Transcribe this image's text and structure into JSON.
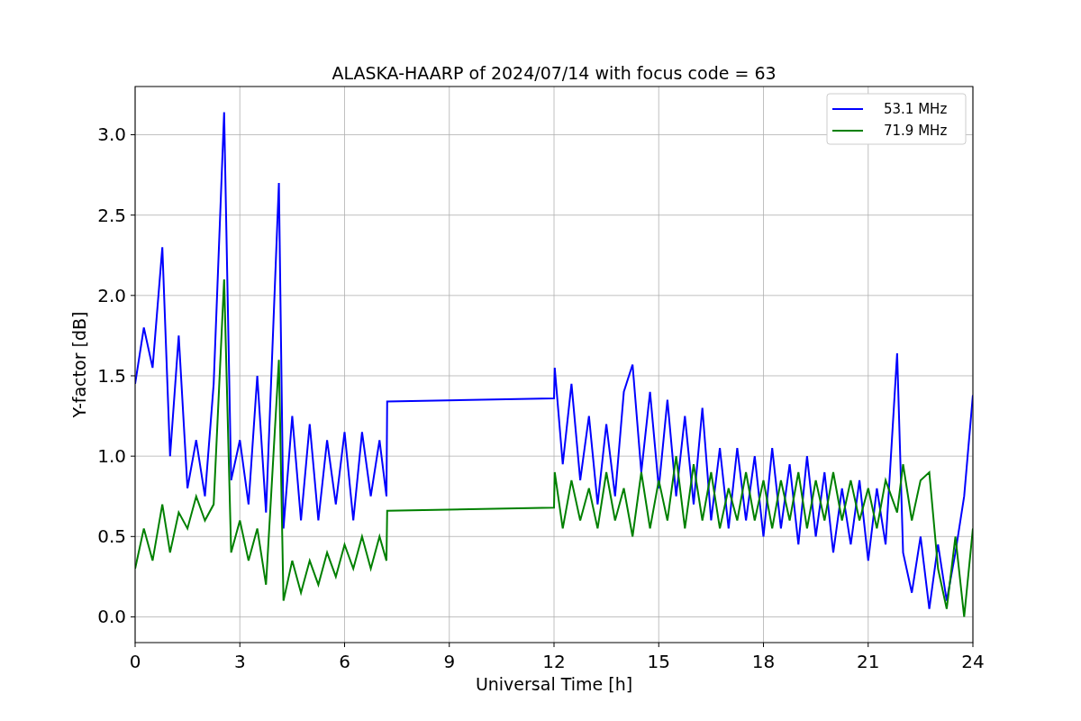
{
  "figure": {
    "chart_data": {
      "type": "line",
      "title": "ALASKA-HAARP of 2024/07/14 with focus code = 63",
      "xlabel": "Universal Time [h]",
      "ylabel": "Y-factor [dB]",
      "x": [
        0,
        0.25,
        0.5,
        0.78,
        1.0,
        1.25,
        1.5,
        1.75,
        2.0,
        2.25,
        2.55,
        2.75,
        3.0,
        3.25,
        3.5,
        3.75,
        4.12,
        4.25,
        4.5,
        4.75,
        5.0,
        5.25,
        5.5,
        5.75,
        6.0,
        6.25,
        6.5,
        6.75,
        7.0,
        7.2,
        7.22,
        12.0,
        12.02,
        12.25,
        12.5,
        12.75,
        13.0,
        13.25,
        13.5,
        13.75,
        14.0,
        14.25,
        14.5,
        14.75,
        15.0,
        15.25,
        15.5,
        15.75,
        16.0,
        16.25,
        16.5,
        16.75,
        17.0,
        17.25,
        17.5,
        17.75,
        18.0,
        18.25,
        18.5,
        18.75,
        19.0,
        19.25,
        19.5,
        19.75,
        20.0,
        20.25,
        20.5,
        20.75,
        21.0,
        21.25,
        21.5,
        21.83,
        22.0,
        22.25,
        22.5,
        22.75,
        23.0,
        23.25,
        23.5,
        23.75,
        24.0
      ],
      "series": [
        {
          "name": "53.1 MHz",
          "color": "#0000ff",
          "values": [
            1.45,
            1.8,
            1.55,
            2.3,
            1.0,
            1.75,
            0.8,
            1.1,
            0.75,
            1.45,
            3.14,
            0.85,
            1.1,
            0.7,
            1.5,
            0.65,
            2.7,
            0.55,
            1.25,
            0.6,
            1.2,
            0.6,
            1.1,
            0.7,
            1.15,
            0.6,
            1.15,
            0.75,
            1.1,
            0.75,
            1.34,
            1.36,
            1.55,
            0.95,
            1.45,
            0.85,
            1.25,
            0.7,
            1.2,
            0.75,
            1.4,
            1.57,
            0.9,
            1.4,
            0.8,
            1.35,
            0.75,
            1.25,
            0.7,
            1.3,
            0.6,
            1.05,
            0.55,
            1.05,
            0.6,
            1.0,
            0.5,
            1.05,
            0.55,
            0.95,
            0.45,
            1.0,
            0.5,
            0.9,
            0.4,
            0.8,
            0.45,
            0.85,
            0.35,
            0.8,
            0.45,
            1.64,
            0.4,
            0.15,
            0.5,
            0.05,
            0.45,
            0.1,
            0.4,
            0.75,
            1.38
          ]
        },
        {
          "name": "71.9 MHz",
          "color": "#008000",
          "values": [
            0.3,
            0.55,
            0.35,
            0.7,
            0.4,
            0.65,
            0.55,
            0.75,
            0.6,
            0.7,
            2.1,
            0.4,
            0.6,
            0.35,
            0.55,
            0.2,
            1.6,
            0.1,
            0.35,
            0.15,
            0.35,
            0.2,
            0.4,
            0.25,
            0.45,
            0.3,
            0.5,
            0.3,
            0.5,
            0.35,
            0.66,
            0.68,
            0.9,
            0.55,
            0.85,
            0.6,
            0.8,
            0.55,
            0.9,
            0.6,
            0.8,
            0.5,
            0.9,
            0.55,
            0.85,
            0.6,
            1.0,
            0.55,
            0.95,
            0.6,
            0.9,
            0.55,
            0.8,
            0.6,
            0.9,
            0.6,
            0.85,
            0.55,
            0.85,
            0.6,
            0.9,
            0.55,
            0.85,
            0.6,
            0.9,
            0.6,
            0.85,
            0.6,
            0.8,
            0.55,
            0.85,
            0.65,
            0.95,
            0.6,
            0.85,
            0.9,
            0.3,
            0.05,
            0.5,
            0.0,
            0.55
          ]
        }
      ],
      "grid": true,
      "legend": true,
      "xlim": [
        0,
        24
      ],
      "ylim": [
        -0.16,
        3.3
      ],
      "xticks": [
        0,
        3,
        6,
        9,
        12,
        15,
        18,
        21,
        24
      ],
      "yticks": [
        {
          "value": 0,
          "label": "0.0"
        },
        {
          "value": 0.5,
          "label": "0.5"
        },
        {
          "value": 1,
          "label": "1.0"
        },
        {
          "value": 1.5,
          "label": "1.5"
        },
        {
          "value": 2,
          "label": "2.0"
        },
        {
          "value": 2.5,
          "label": "2.5"
        },
        {
          "value": 3,
          "label": "3.0"
        }
      ]
    }
  }
}
